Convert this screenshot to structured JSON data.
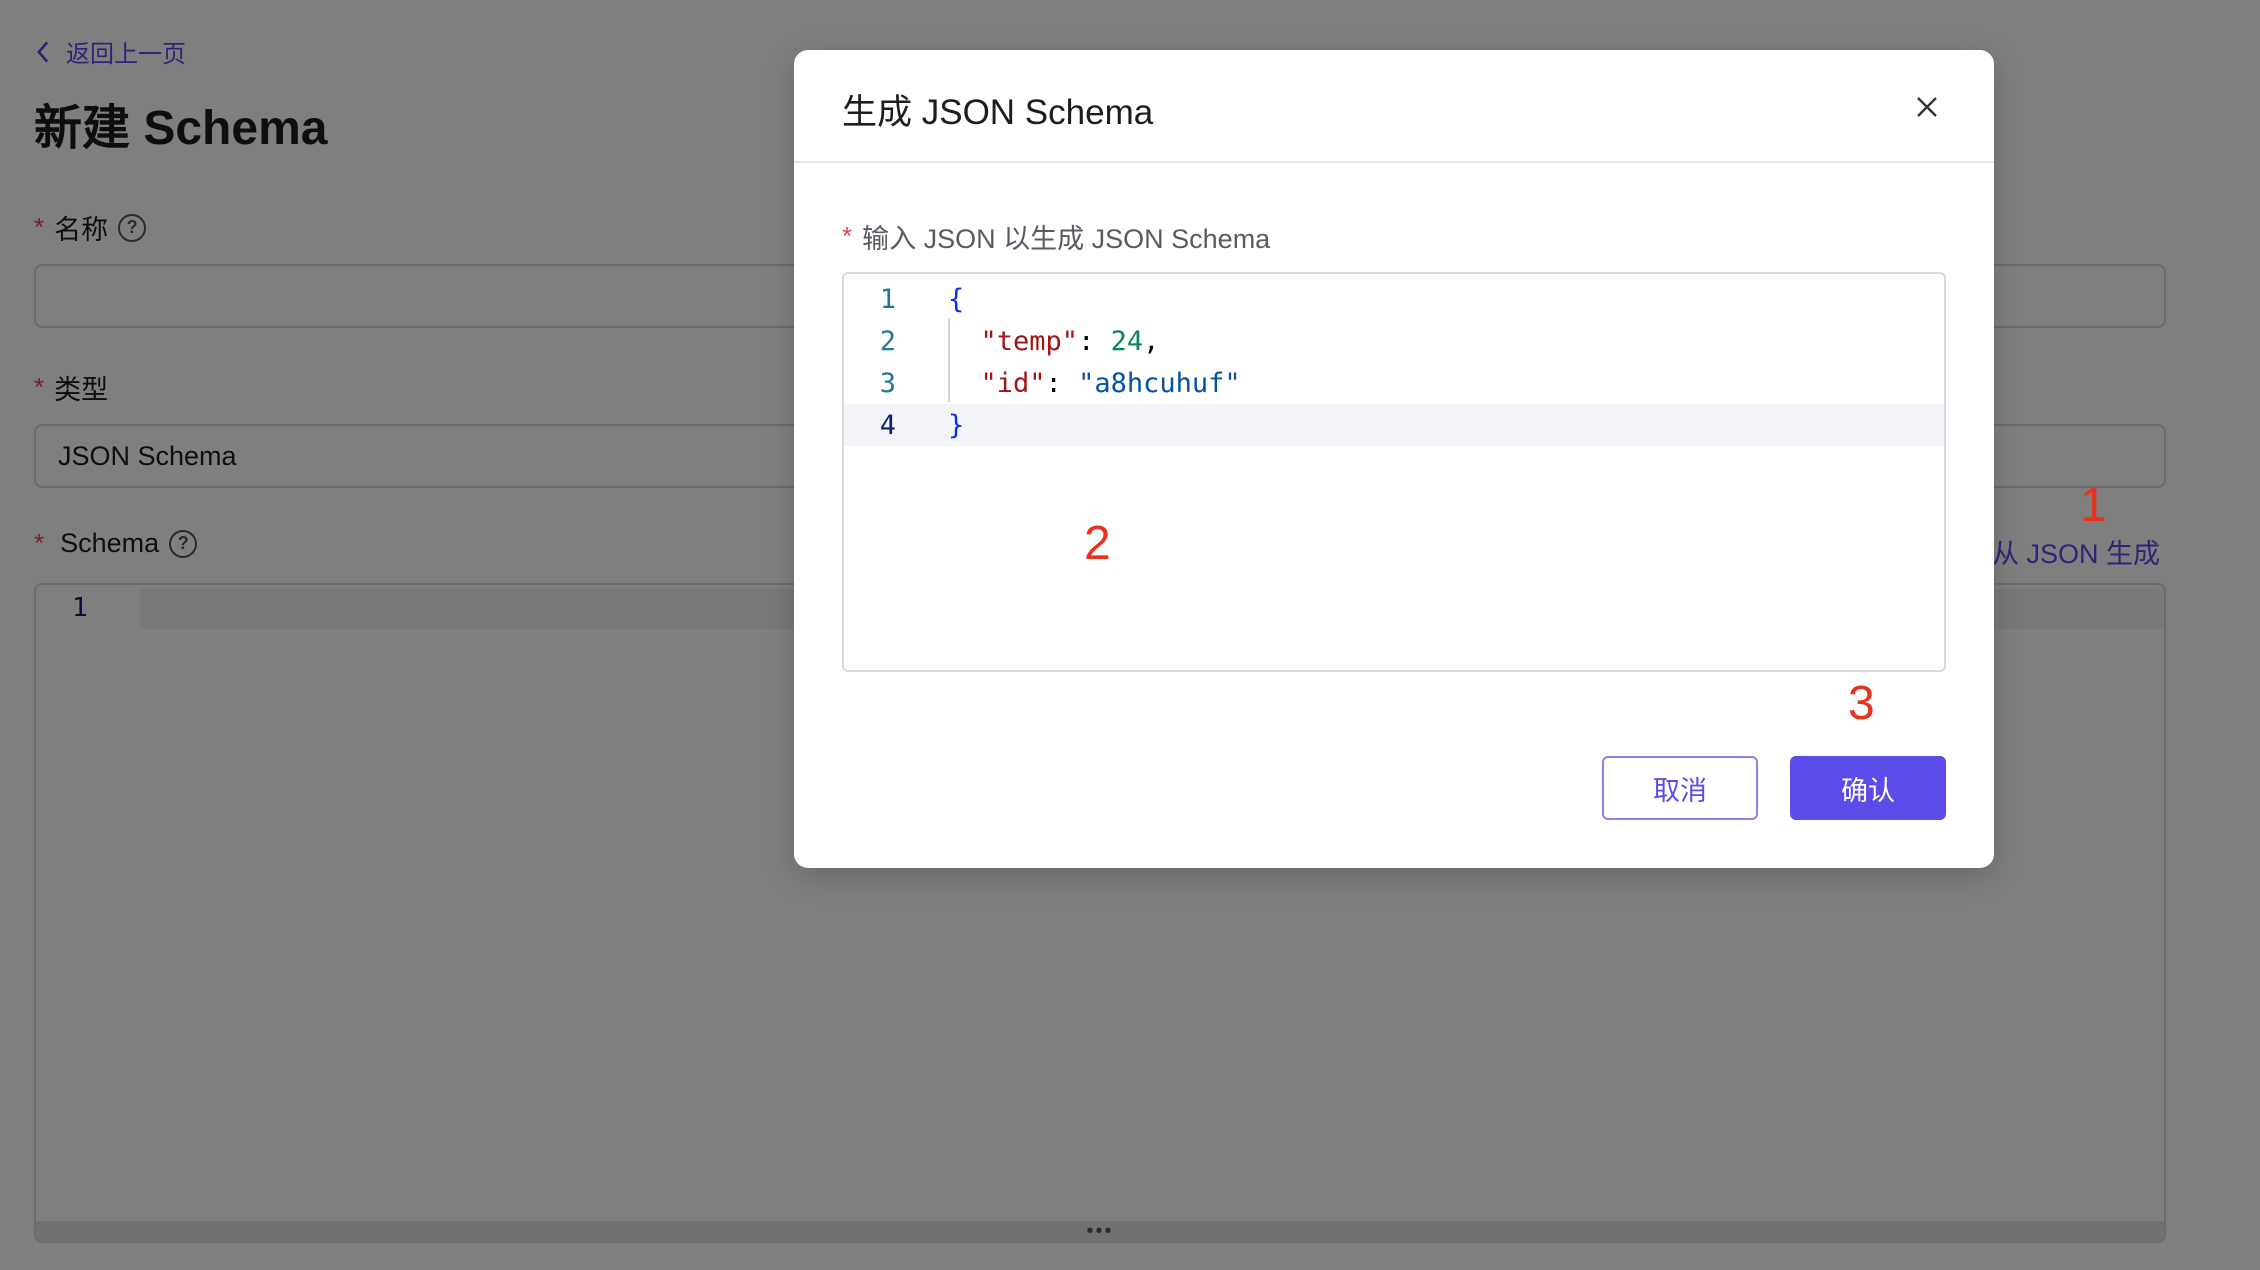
{
  "page": {
    "back_label": "返回上一页",
    "title": "新建 Schema",
    "fields": {
      "name_label": "名称",
      "type_label": "类型",
      "type_value": "JSON Schema",
      "schema_label": "Schema",
      "required_mark": "*"
    },
    "generate_link": "从 JSON 生成",
    "editor_line": "1"
  },
  "modal": {
    "title": "生成 JSON Schema",
    "input_label": "输入 JSON 以生成 JSON Schema",
    "required_mark": "*",
    "code_lines": [
      {
        "num": "1"
      },
      {
        "num": "2",
        "key": "\"temp\"",
        "value": "24"
      },
      {
        "num": "3",
        "key": "\"id\"",
        "value": "\"a8hcuhuf\""
      },
      {
        "num": "4"
      }
    ],
    "open_brace": "{",
    "close_brace": "}",
    "cancel_label": "取消",
    "confirm_label": "确认"
  },
  "annotations": [
    "1",
    "2",
    "3"
  ],
  "colors": {
    "accent": "#5b4be8",
    "annotation": "#e8321e",
    "required": "#e5484d"
  }
}
